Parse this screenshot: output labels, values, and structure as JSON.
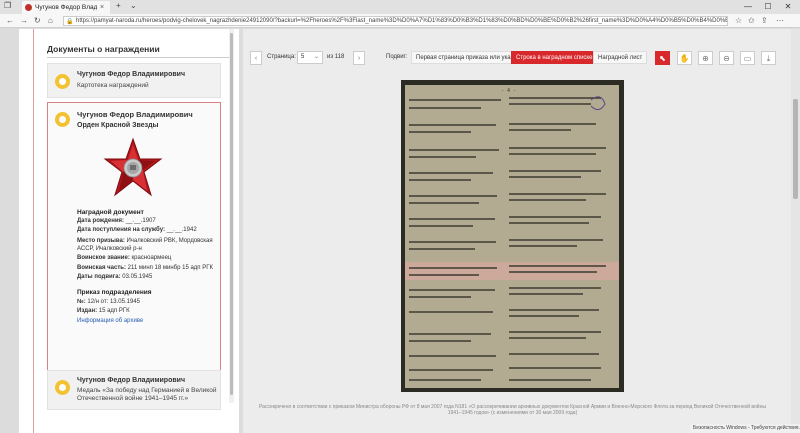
{
  "browser": {
    "tab_title": "Чугунов Федор Владим",
    "tab_close": "×",
    "new_tab": "+",
    "tab_list": "⌄",
    "url": "https://pamyat-naroda.ru/heroes/podvig-chelovek_nagrazhdenie24912090/?backurl=%2Fheroes%2F%3Flast_name%3D%D0%A7%D1%83%D0%B3%D1%83%D0%BD%D0%BE%D0%B2%26first_name%3D%D0%A4%D0%B5%D0%B4%D0%BE%D1%80%26m",
    "back": "←",
    "forward": "→",
    "reload": "↻",
    "home": "⌂",
    "min": "—",
    "max": "☐",
    "close": "✕"
  },
  "left_panel": {
    "title": "Документы о награждении",
    "card1": {
      "name": "Чугунов Федор Владимирович",
      "subtitle": "Картотека награждений"
    },
    "card2": {
      "name": "Чугунов Федор Владимирович",
      "award": "Орден Красной Звезды",
      "section1_title": "Наградной документ",
      "fields": [
        {
          "label": "Дата рождения:",
          "value": "__.__.1907"
        },
        {
          "label": "Дата поступления на службу:",
          "value": "__.__.1942"
        },
        {
          "label": "Место призыва:",
          "value": "Ичалковский РВК, Мордовская АССР, Ичалковский р-н"
        },
        {
          "label": "Воинское звание:",
          "value": "красноармеец"
        },
        {
          "label": "Воинская часть:",
          "value": "211 минп 18 минбр 15 адп РГК"
        },
        {
          "label": "Даты подвига:",
          "value": "03.05.1945"
        }
      ],
      "section2_title": "Приказ подразделения",
      "order_fields": [
        {
          "label": "№:",
          "value": "12/н от: 13.05.1945"
        },
        {
          "label": "Издан:",
          "value": "15 адп РГК"
        }
      ],
      "info_link": "Информация об архиве"
    },
    "card3": {
      "name": "Чугунов Федор Владимирович",
      "subtitle": "Медаль «За победу над Германией в Великой Отечественной войне 1941–1945 гг.»"
    }
  },
  "viewer": {
    "page_label": "Страница:",
    "page_value": "5",
    "page_of": "из 118",
    "pager_prev": "‹",
    "pager_next": "›",
    "show_label": "Подвиг:",
    "btn_first_page": "Первая страница приказа или указа",
    "btn_row": "Строка в наградном списке",
    "btn_sheet": "Наградной лист",
    "footer": "Рассекречено в соответствии с приказом Министра обороны РФ от 8 мая 2007 года N181 «О рассекречивании архивных документов Красной Армии и Военно-Морского Флота за период Великой Отечественной войны 1941–1945 годов» (с изменениями от 30 мая 2009 года)"
  },
  "os": {
    "toast": "Безопасность Windows - Требуются действия."
  },
  "colors": {
    "accent": "#d8282c",
    "medal": "#f2c233",
    "link": "#2a5db0"
  }
}
